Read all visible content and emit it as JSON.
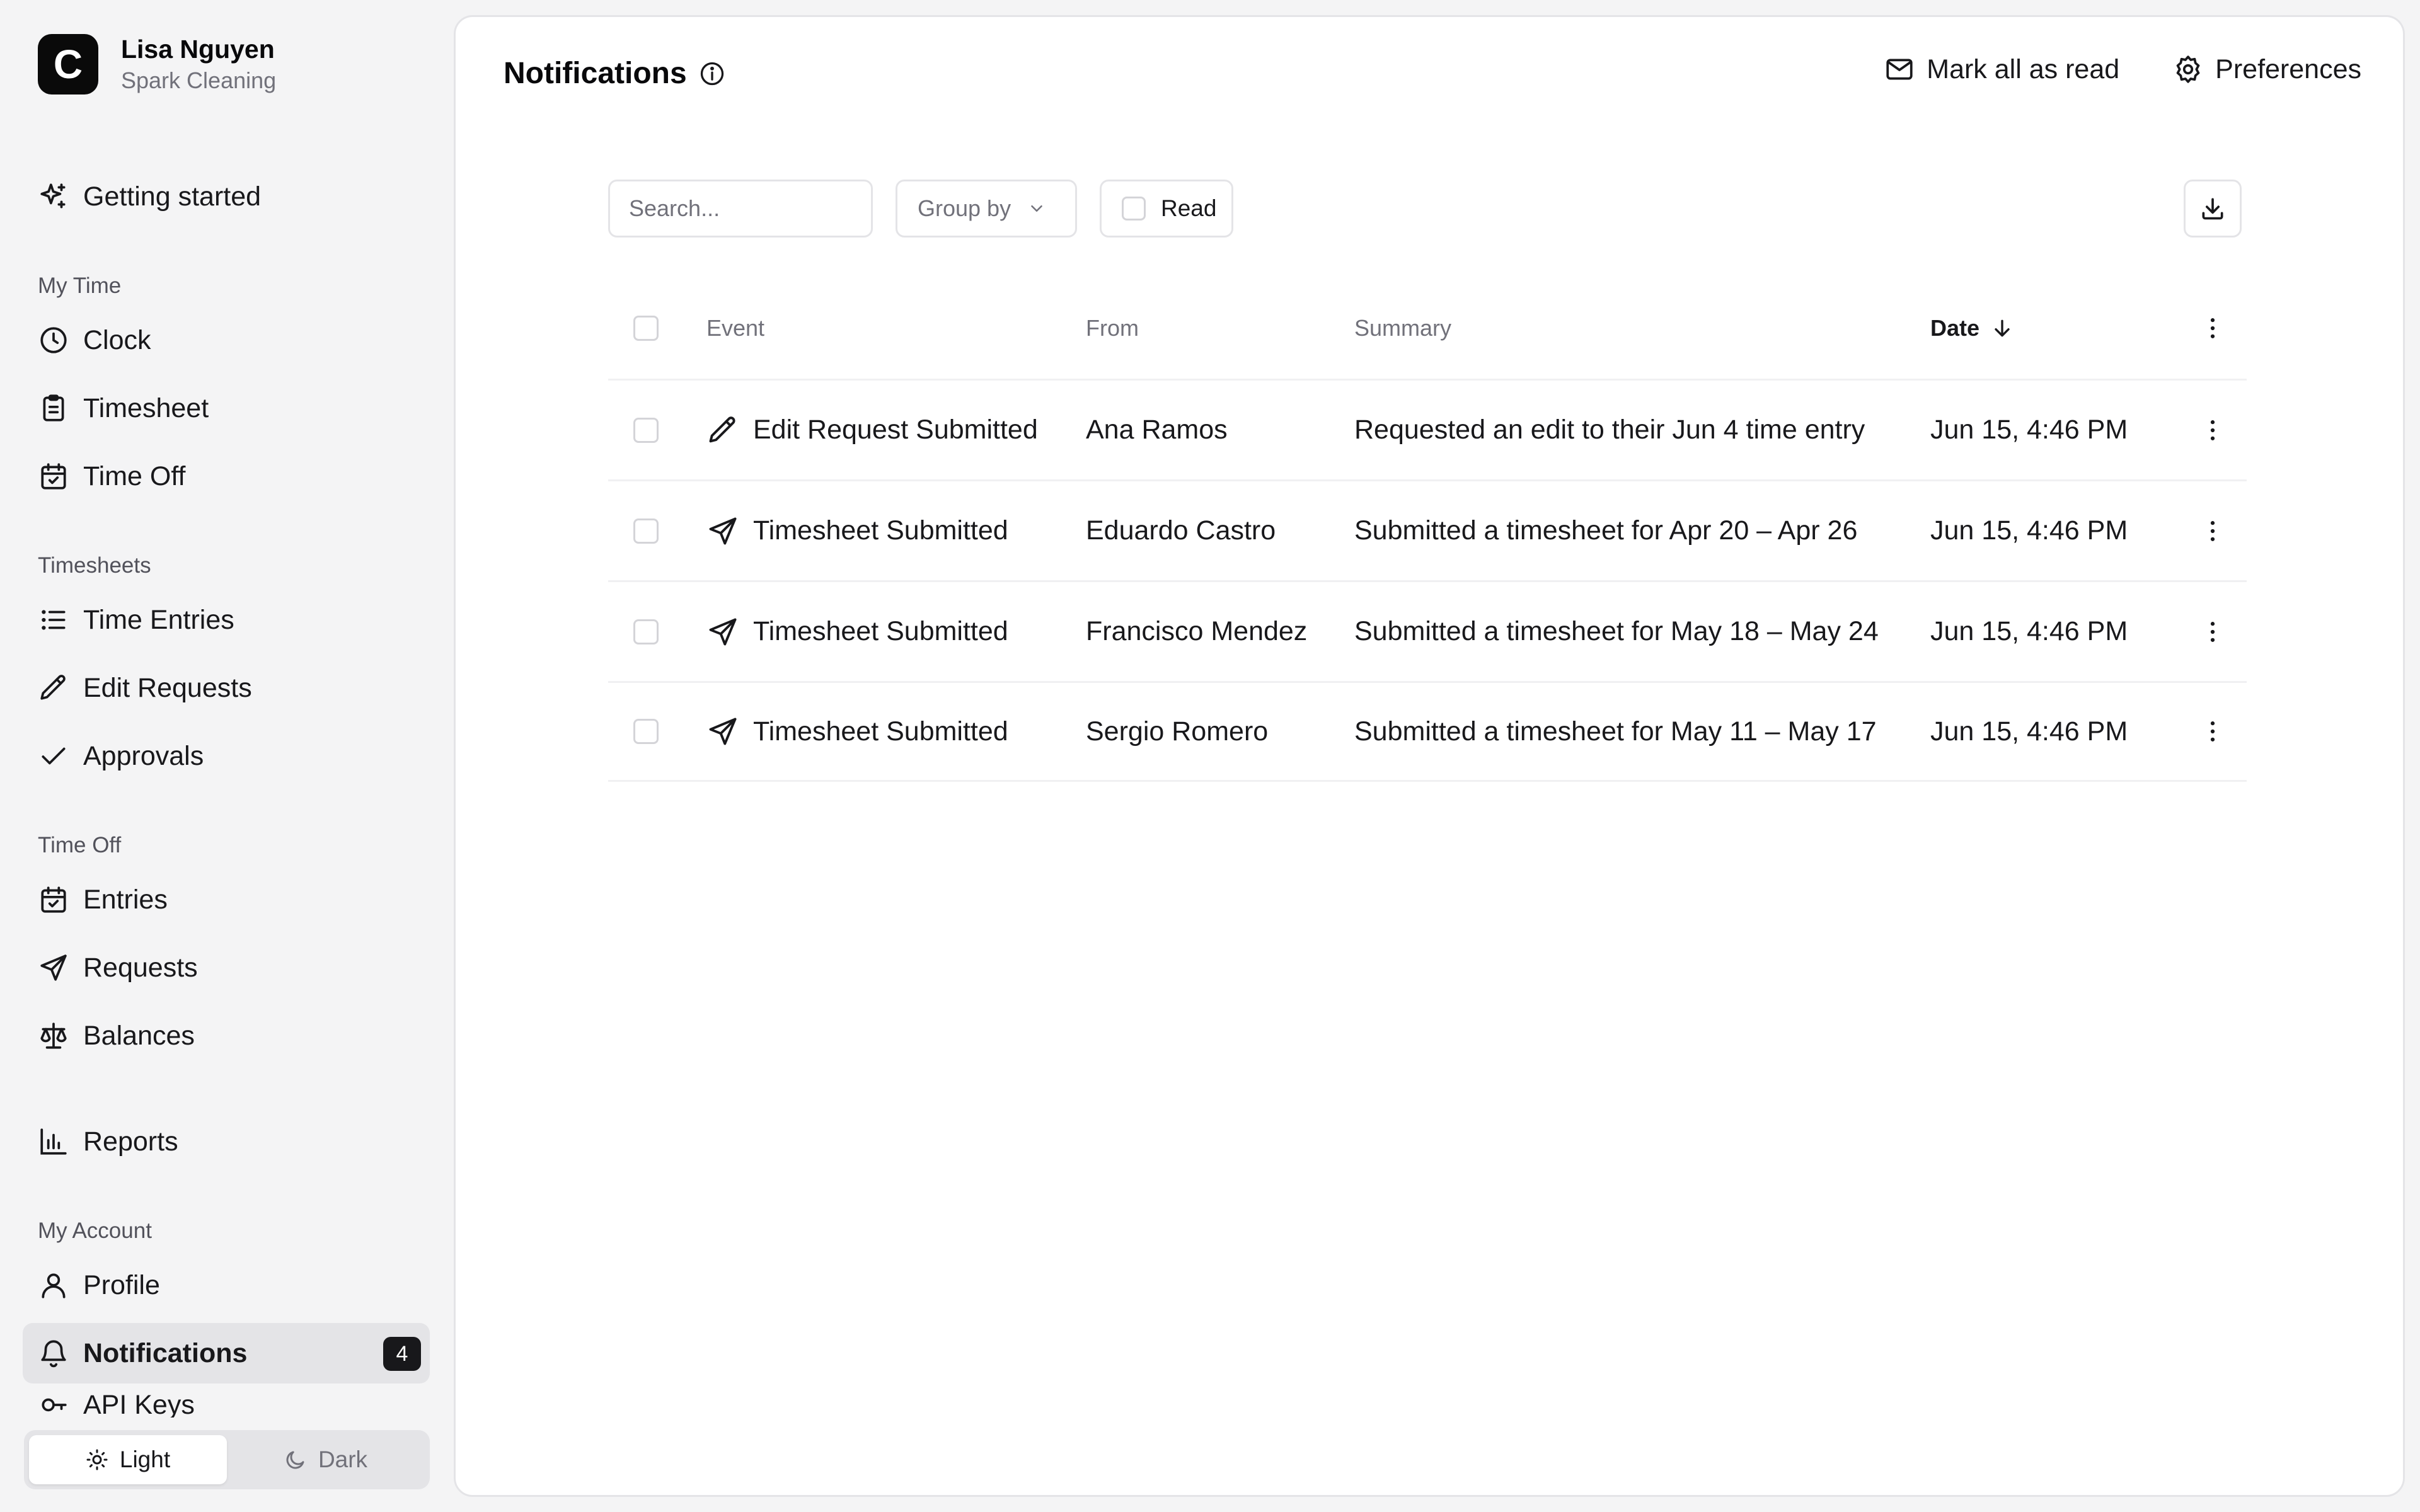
{
  "account": {
    "logo_letter": "C",
    "name": "Lisa Nguyen",
    "company": "Spark Cleaning"
  },
  "sidebar": {
    "getting_started": "Getting started",
    "sections": {
      "my_time": "My Time",
      "timesheets": "Timesheets",
      "time_off": "Time Off",
      "my_account": "My Account"
    },
    "items": {
      "clock": "Clock",
      "timesheet": "Timesheet",
      "time_off": "Time Off",
      "time_entries": "Time Entries",
      "edit_requests": "Edit Requests",
      "approvals": "Approvals",
      "entries": "Entries",
      "requests": "Requests",
      "balances": "Balances",
      "reports": "Reports",
      "profile": "Profile",
      "notifications": "Notifications",
      "api": "API Keys"
    },
    "notifications_badge": "4",
    "active_item": "notifications"
  },
  "theme": {
    "light_label": "Light",
    "dark_label": "Dark",
    "selected": "light"
  },
  "header": {
    "title": "Notifications",
    "mark_all_label": "Mark all as read",
    "preferences_label": "Preferences"
  },
  "toolbar": {
    "search_placeholder": "Search...",
    "group_by_label": "Group by",
    "read_label": "Read"
  },
  "table": {
    "columns": {
      "event": "Event",
      "from": "From",
      "summary": "Summary",
      "date": "Date"
    },
    "sort": "date-desc",
    "rows": [
      {
        "icon": "pencil-icon",
        "event": "Edit Request Submitted",
        "from": "Ana Ramos",
        "summary": "Requested an edit to their Jun 4 time entry",
        "date": "Jun 15, 4:46 PM"
      },
      {
        "icon": "send-icon",
        "event": "Timesheet Submitted",
        "from": "Eduardo Castro",
        "summary": "Submitted a timesheet for Apr 20 – Apr 26",
        "date": "Jun 15, 4:46 PM"
      },
      {
        "icon": "send-icon",
        "event": "Timesheet Submitted",
        "from": "Francisco Mendez",
        "summary": "Submitted a timesheet for May 18 – May 24",
        "date": "Jun 15, 4:46 PM"
      },
      {
        "icon": "send-icon",
        "event": "Timesheet Submitted",
        "from": "Sergio Romero",
        "summary": "Submitted a timesheet for May 11 – May 17",
        "date": "Jun 15, 4:46 PM"
      }
    ]
  },
  "colors": {
    "sidebar_bg": "#f4f4f5",
    "active_bg": "#e4e4e7",
    "badge_bg": "#18181b",
    "border": "#e4e4e7",
    "muted_text": "#71717a"
  }
}
